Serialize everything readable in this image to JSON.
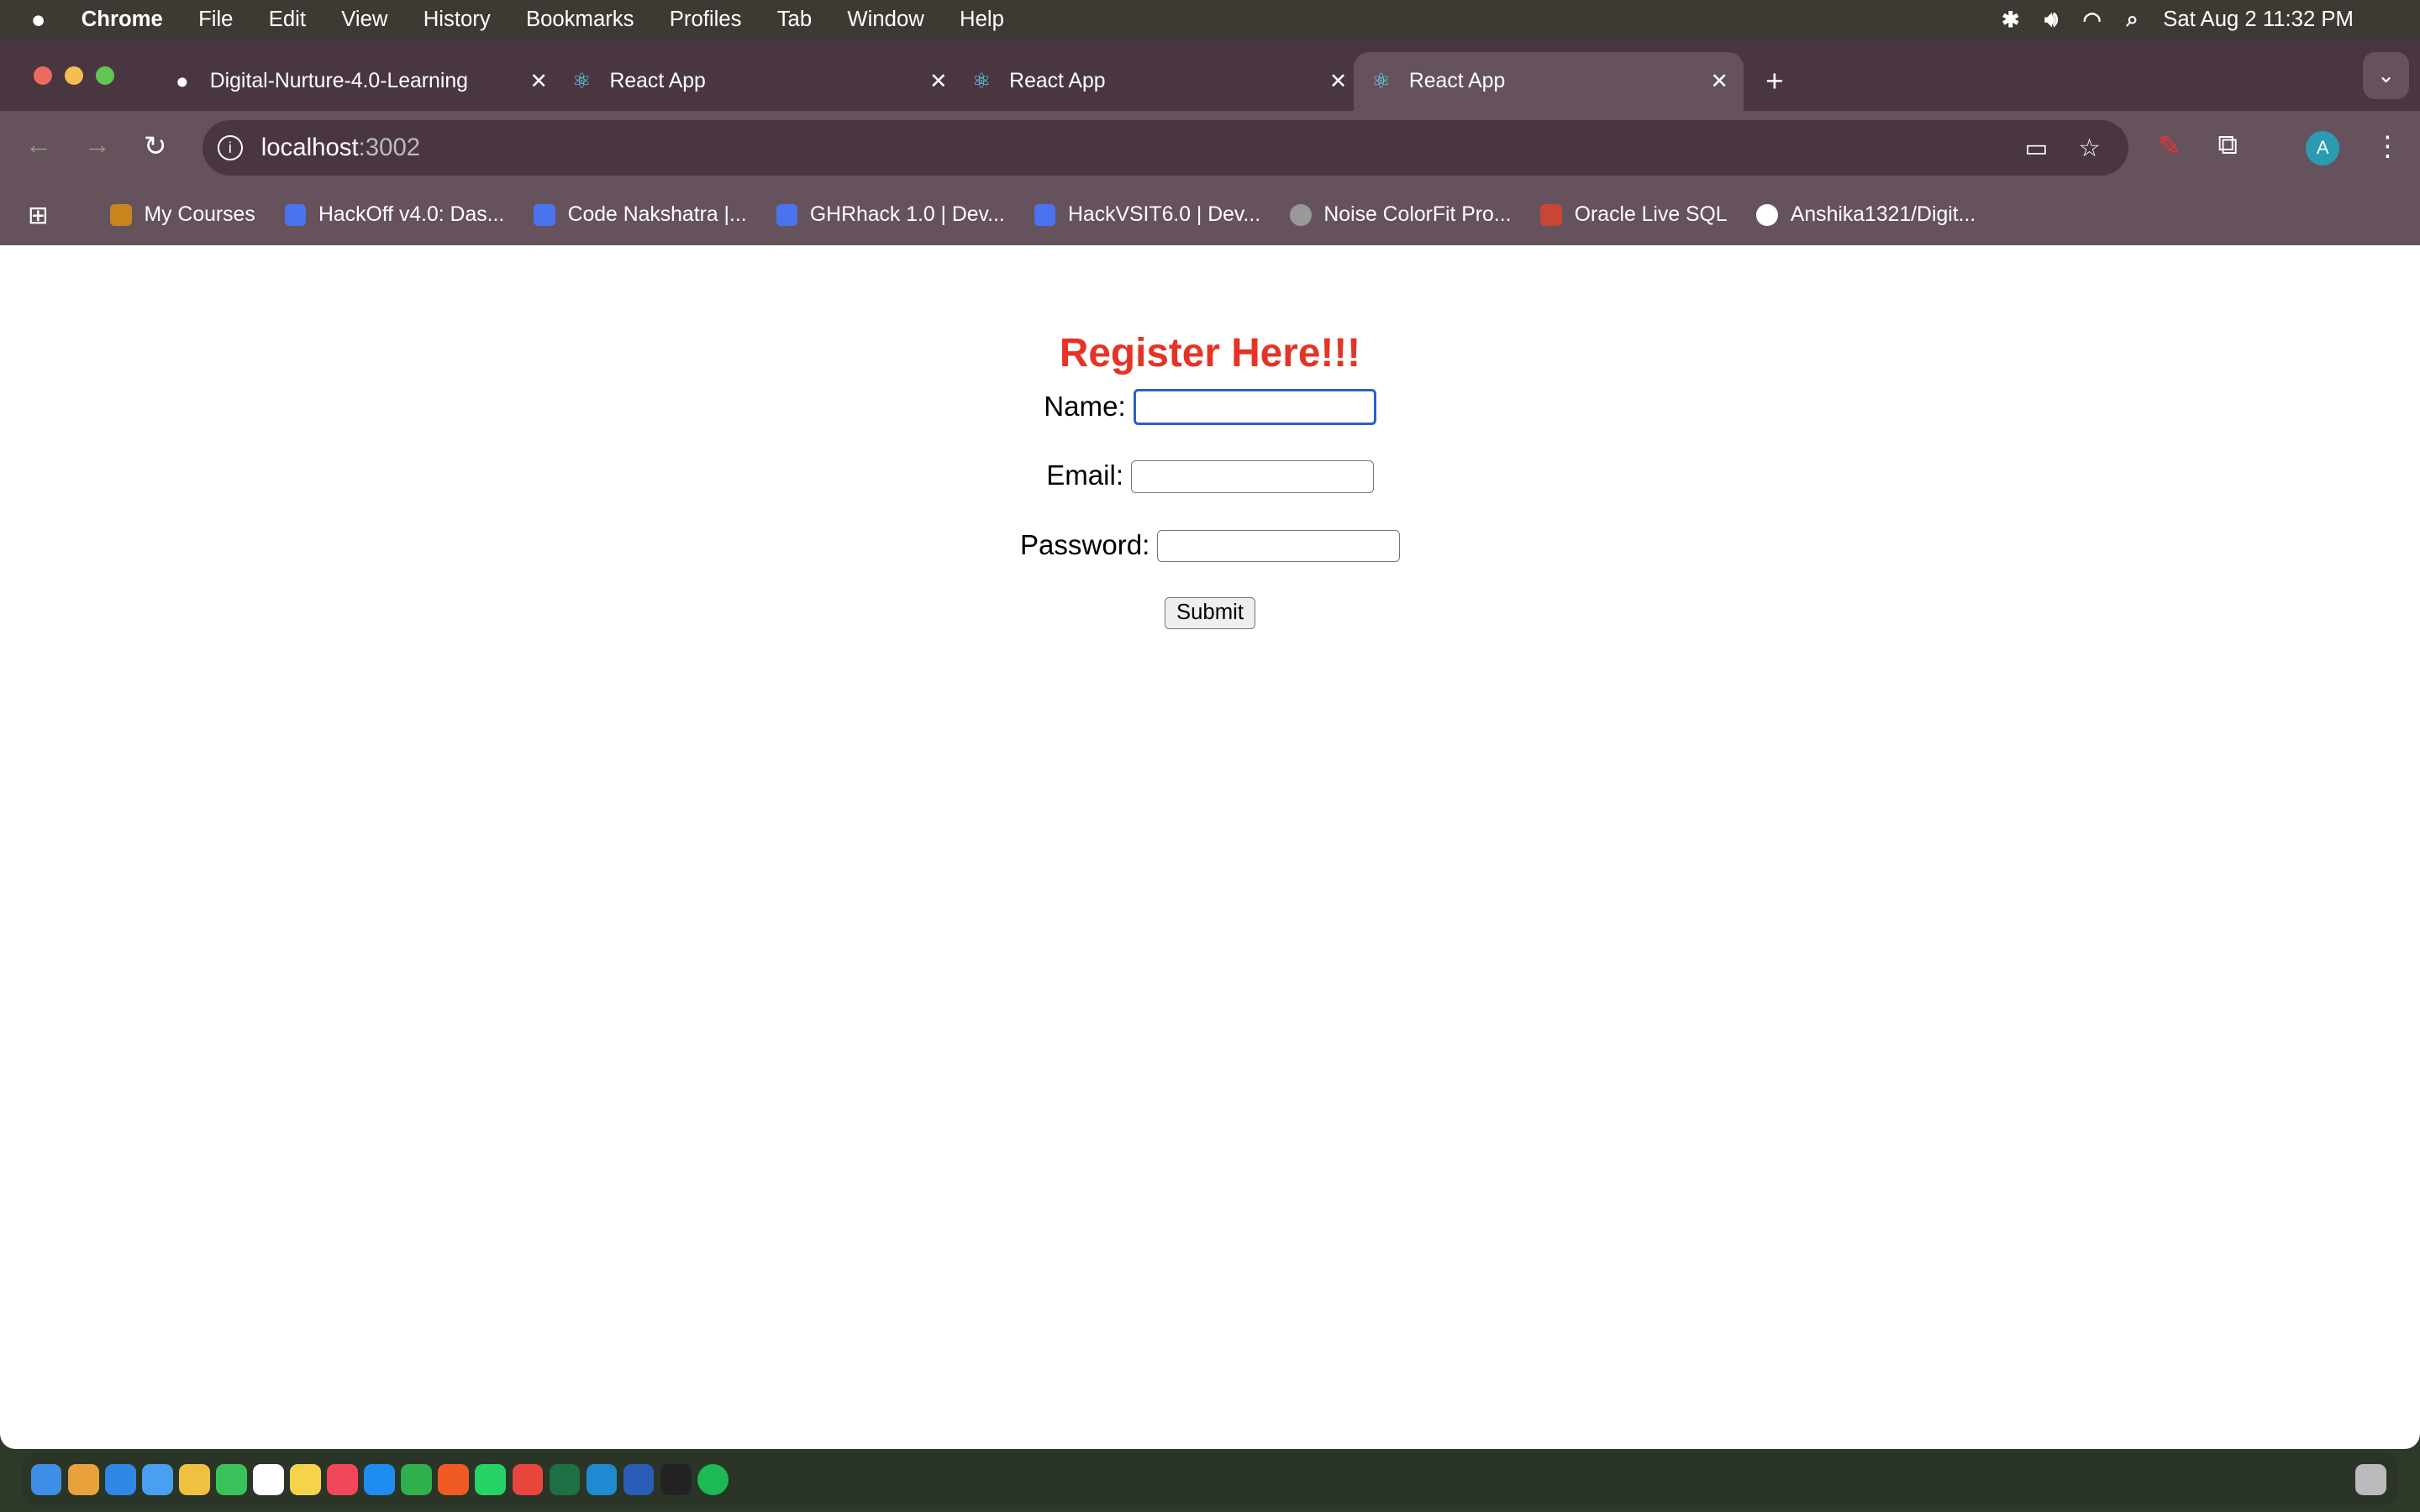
{
  "menubar": {
    "app": "Chrome",
    "items": [
      "File",
      "Edit",
      "View",
      "History",
      "Bookmarks",
      "Profiles",
      "Tab",
      "Window",
      "Help"
    ],
    "datetime": "Sat Aug 2  11:32 PM"
  },
  "tabs": [
    {
      "title": "Digital-Nurture-4.0-Learning",
      "icon": "github-icon"
    },
    {
      "title": "React App",
      "icon": "react-icon"
    },
    {
      "title": "React App",
      "icon": "react-icon"
    },
    {
      "title": "React App",
      "icon": "react-icon",
      "active": true
    }
  ],
  "address": {
    "host": "localhost",
    "port": ":3002"
  },
  "bookmarks": [
    "My Courses",
    "HackOff v4.0: Das...",
    "Code Nakshatra |...",
    "GHRhack 1.0 | Dev...",
    "HackVSIT6.0 | Dev...",
    "Noise ColorFit Pro...",
    "Oracle Live SQL",
    "Anshika1321/Digit..."
  ],
  "profile": {
    "initial": "A"
  },
  "form": {
    "title": "Register Here!!!",
    "name_label": "Name:",
    "email_label": "Email:",
    "password_label": "Password:",
    "name_value": "",
    "email_value": "",
    "password_value": "",
    "submit": "Submit"
  },
  "colors": {
    "title": "#e53325",
    "focus": "#2a5fcb",
    "chrome": "#4a3641"
  }
}
